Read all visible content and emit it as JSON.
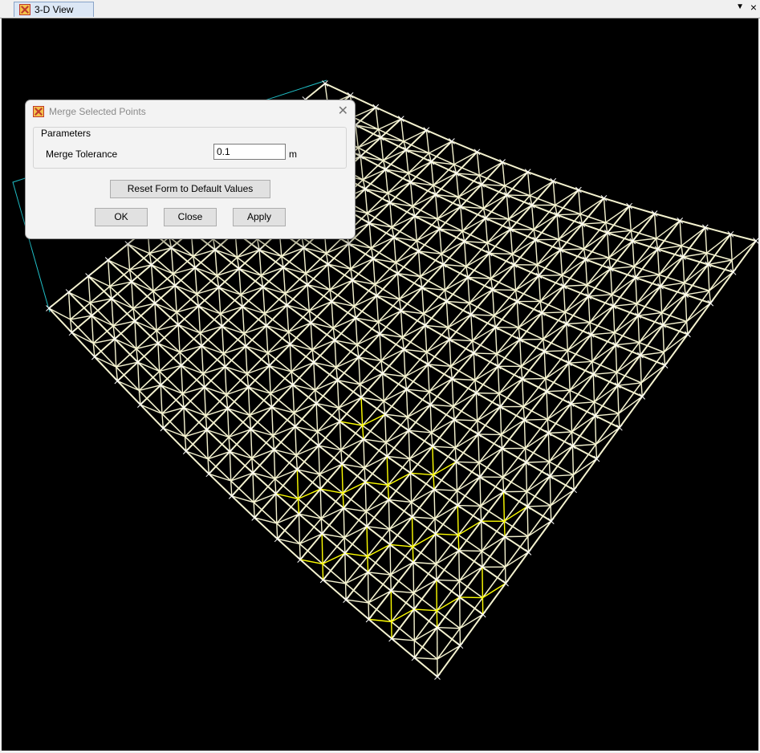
{
  "tab": {
    "title": "3-D View",
    "dropdown_icon": "chevron-down-icon",
    "close_icon": "close-icon"
  },
  "colors": {
    "viewport_bg": "#000000",
    "member": "#f5f3d0",
    "selected_member": "#ffff00",
    "outline": "#20c0c8",
    "joint": "#ffffff"
  },
  "dialog": {
    "title": "Merge Selected Points",
    "group_label": "Parameters",
    "field_label": "Merge Tolerance",
    "field_value": "0.1",
    "unit": "m",
    "reset_button": "Reset Form to Default Values",
    "ok_button": "OK",
    "close_button": "Close",
    "apply_button": "Apply"
  }
}
